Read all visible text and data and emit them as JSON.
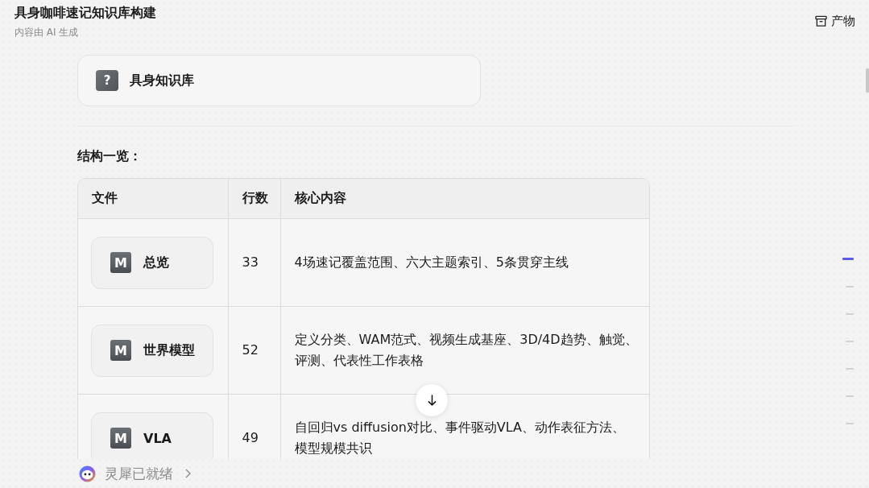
{
  "header": {
    "title": "具身咖啡速记知识库构建",
    "subtitle": "内容由 AI 生成",
    "artifacts_button": {
      "label": "产物"
    }
  },
  "knowledge_card": {
    "icon": "?",
    "title": "具身知识库"
  },
  "section_heading": "结构一览：",
  "table": {
    "columns": [
      "文件",
      "行数",
      "核心内容"
    ],
    "rows": [
      {
        "file": {
          "icon": "M",
          "label": "总览"
        },
        "lines": "33",
        "content": "4场速记覆盖范围、六大主题索引、5条贯穿主线"
      },
      {
        "file": {
          "icon": "M",
          "label": "世界模型"
        },
        "lines": "52",
        "content": "定义分类、WAM范式、视频生成基座、3D/4D趋势、触觉、评测、代表性工作表格"
      },
      {
        "file": {
          "icon": "M",
          "label": "VLA"
        },
        "lines": "49",
        "content": "自回归vs diffusion对比、事件驱动VLA、动作表征方法、模型规模共识"
      }
    ]
  },
  "outline_marks": [
    {
      "selected": true
    },
    {
      "selected": false
    },
    {
      "selected": false
    },
    {
      "selected": false
    },
    {
      "selected": false
    },
    {
      "selected": false
    },
    {
      "selected": false
    }
  ],
  "status_bar": {
    "label": "灵犀已就绪"
  }
}
